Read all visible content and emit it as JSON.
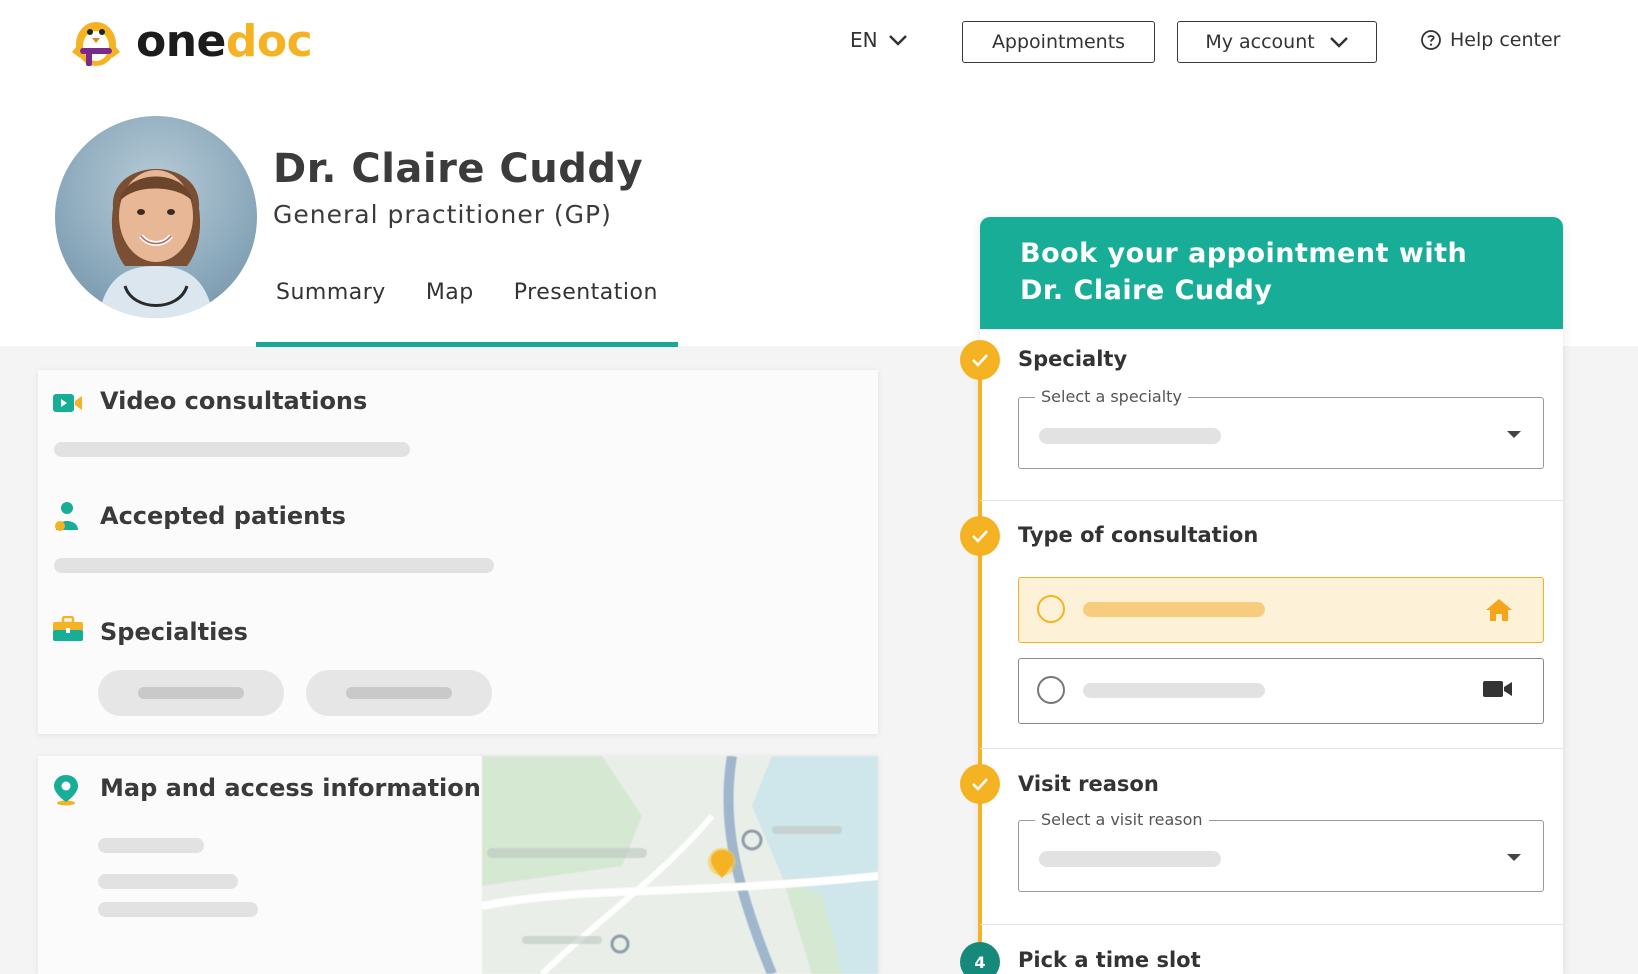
{
  "brand": {
    "logo_one": "one",
    "logo_doc": "doc",
    "accent": "#f5b324",
    "teal": "#18ad97"
  },
  "header": {
    "language": "EN",
    "appointments_label": "Appointments",
    "account_label": "My account",
    "help_label": "Help center"
  },
  "doctor": {
    "name": "Dr. Claire Cuddy",
    "specialty": "General practitioner (GP)"
  },
  "tabs": [
    {
      "label": "Summary",
      "active": true
    },
    {
      "label": "Map"
    },
    {
      "label": "Presentation"
    }
  ],
  "sections": {
    "video": "Video consultations",
    "patients": "Accepted patients",
    "specialties": "Specialties",
    "map": "Map and access information"
  },
  "booking": {
    "title": "Book your appointment with Dr. Claire Cuddy",
    "steps": [
      {
        "title": "Specialty",
        "field_label": "Select a specialty",
        "status": "done"
      },
      {
        "title": "Type of consultation",
        "status": "done",
        "options": [
          {
            "icon": "home-icon",
            "selected": true
          },
          {
            "icon": "video-camera-icon",
            "selected": false
          }
        ]
      },
      {
        "title": "Visit reason",
        "field_label": "Select a visit reason",
        "status": "done"
      },
      {
        "title": "Pick a time slot",
        "number": "4",
        "status": "current"
      }
    ]
  }
}
